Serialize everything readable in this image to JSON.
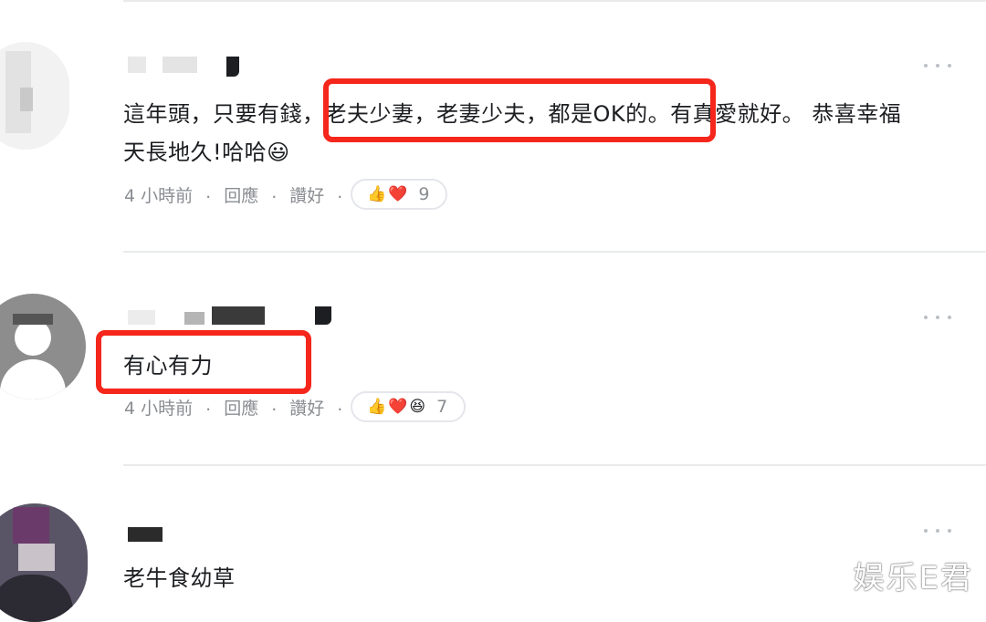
{
  "comments": [
    {
      "text_line1": "這年頭，只要有錢，老夫少妻，老妻少夫，都是OK的。有真愛就好。 恭喜幸福",
      "text_line2": "天長地久!哈哈😃",
      "time": "4 小時前",
      "reply_label": "回應",
      "like_label": "讚好",
      "reactions": [
        "👍",
        "❤️"
      ],
      "reaction_count": "9"
    },
    {
      "text_line1": "有心有力",
      "time": "4 小時前",
      "reply_label": "回應",
      "like_label": "讚好",
      "reactions": [
        "👍",
        "❤️",
        "😆"
      ],
      "reaction_count": "7"
    },
    {
      "text_line1": "老牛食幼草"
    }
  ],
  "watermark": "娱乐E君",
  "colors": {
    "highlight": "#f5261b",
    "meta_text": "#8a8d91",
    "divider": "#e9eaec"
  }
}
